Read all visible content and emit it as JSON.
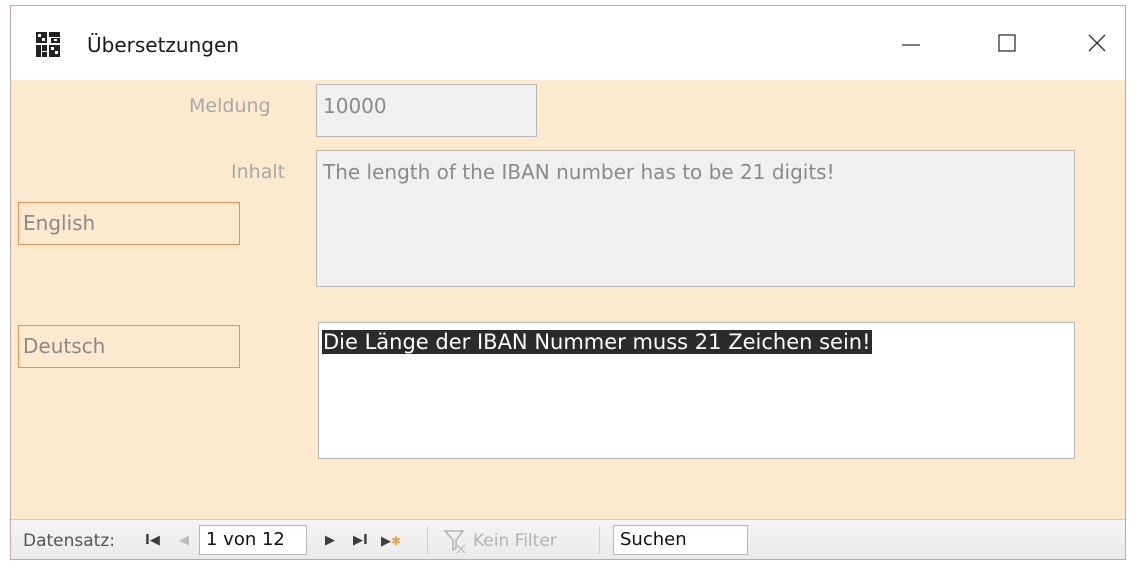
{
  "window": {
    "title": "Übersetzungen"
  },
  "form": {
    "meldung_label": "Meldung",
    "meldung_value": "10000",
    "inhalt_label": "Inhalt",
    "inhalt_value": "The length of the IBAN number has to be 21 digits!",
    "english_label": "English",
    "deutsch_label": "Deutsch",
    "deutsch_value": "Die Länge der IBAN Nummer muss 21 Zeichen sein!"
  },
  "navigation": {
    "record_label": "Datensatz:",
    "record_position": "1 von 12",
    "filter_label": "Kein Filter",
    "search_value": "Suchen"
  },
  "icons": {
    "app": "access-form-icon",
    "minimize": "minimize-icon",
    "maximize": "maximize-icon",
    "close": "close-icon",
    "first": "first-record-icon",
    "prev": "previous-record-icon",
    "next": "next-record-icon",
    "last": "last-record-icon",
    "new": "new-record-icon",
    "filter": "filter-icon"
  },
  "colors": {
    "form_background": "#fde9ce",
    "label_border": "#e0955f",
    "selection": "#2b2b2b"
  }
}
